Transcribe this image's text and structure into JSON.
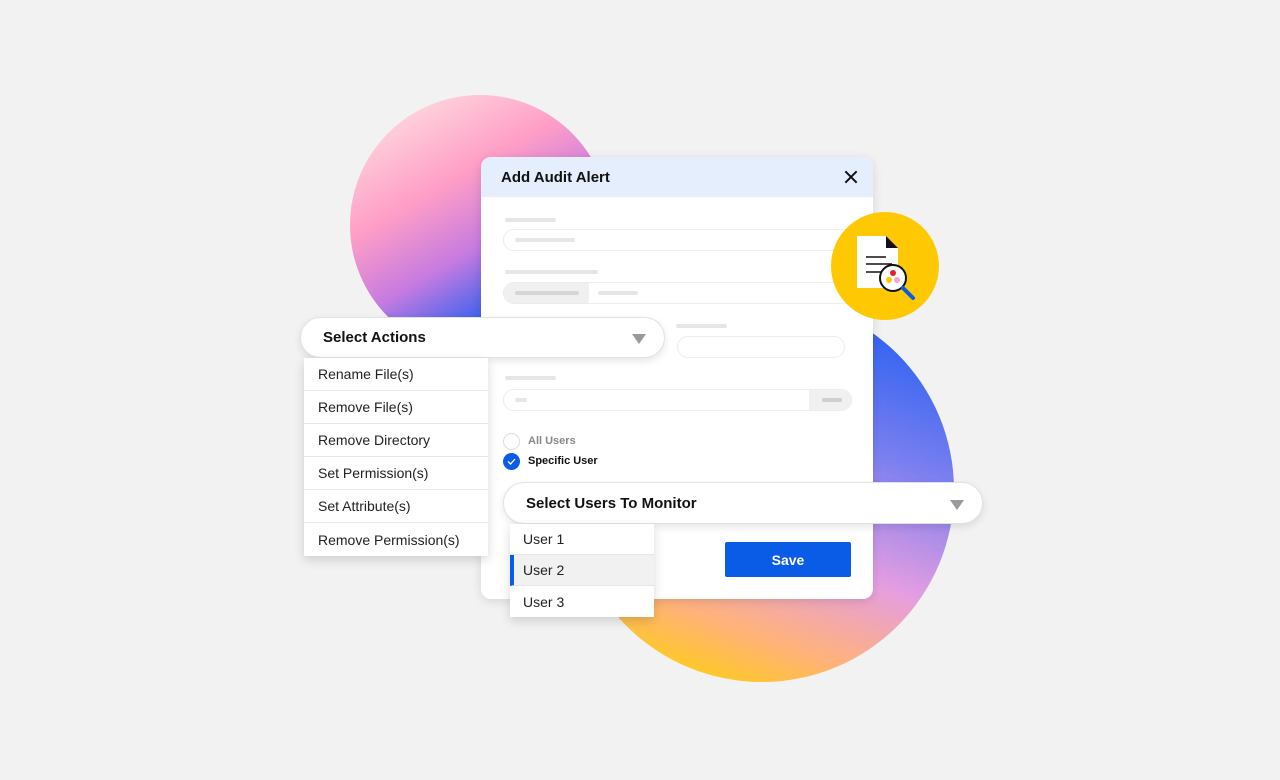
{
  "dialog": {
    "title": "Add Audit Alert"
  },
  "actions": {
    "label": "Select Actions",
    "items": [
      "Rename File(s)",
      "Remove File(s)",
      "Remove Directory",
      "Set Permission(s)",
      "Set Attribute(s)",
      "Remove Permission(s)"
    ]
  },
  "radios": {
    "all": "All Users",
    "specific": "Specific User",
    "selected": "Specific User"
  },
  "users": {
    "label": "Select Users To Monitor",
    "items": [
      "User 1",
      "User 2",
      "User 3"
    ],
    "selected": "User 2"
  },
  "save_label": "Save",
  "colors": {
    "accent": "#0a5be6",
    "header": "#e5eefc",
    "badge": "#fec803"
  },
  "icons": {
    "badge": "document-search-icon",
    "close": "close-icon",
    "dropdown": "caret-down-icon"
  }
}
